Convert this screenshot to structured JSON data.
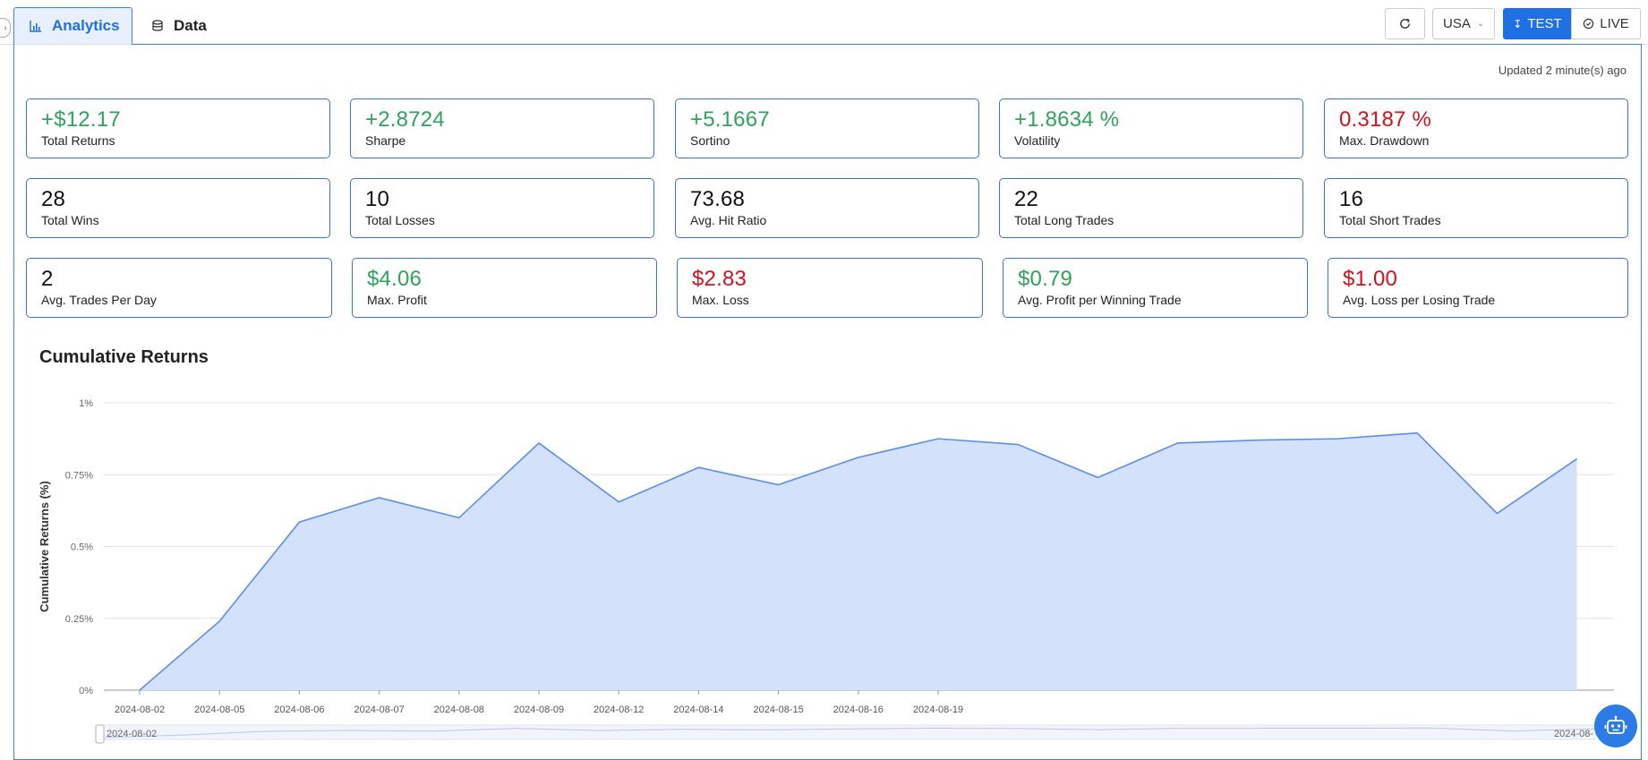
{
  "tabs": [
    {
      "label": "Analytics",
      "icon": "bar-chart-icon",
      "active": true
    },
    {
      "label": "Data",
      "icon": "database-icon",
      "active": false
    }
  ],
  "toolbar": {
    "refresh_icon": "refresh-icon",
    "market": "USA",
    "test_label": "TEST",
    "live_label": "LIVE",
    "accent_color": "#1f6fe5"
  },
  "updated_text": "Updated 2 minute(s) ago",
  "metrics_row1": [
    {
      "value": "+$12.17",
      "label": "Total Returns",
      "tone": "pos"
    },
    {
      "value": "+2.8724",
      "label": "Sharpe",
      "tone": "pos"
    },
    {
      "value": "+5.1667",
      "label": "Sortino",
      "tone": "pos"
    },
    {
      "value": "+1.8634 %",
      "label": "Volatility",
      "tone": "pos"
    },
    {
      "value": "0.3187 %",
      "label": "Max. Drawdown",
      "tone": "neg"
    }
  ],
  "metrics_row2": [
    {
      "value": "28",
      "label": "Total Wins",
      "tone": "neutral"
    },
    {
      "value": "10",
      "label": "Total Losses",
      "tone": "neutral"
    },
    {
      "value": "73.68",
      "label": "Avg. Hit Ratio",
      "tone": "neutral"
    },
    {
      "value": "22",
      "label": "Total Long Trades",
      "tone": "neutral"
    },
    {
      "value": "16",
      "label": "Total Short Trades",
      "tone": "neutral"
    }
  ],
  "metrics_row3": [
    {
      "value": "2",
      "label": "Avg. Trades Per Day",
      "tone": "neutral"
    },
    {
      "value": "$4.06",
      "label": "Max. Profit",
      "tone": "pos"
    },
    {
      "value": "$2.83",
      "label": "Max. Loss",
      "tone": "neg"
    },
    {
      "value": "$0.79",
      "label": "Avg. Profit per Winning Trade",
      "tone": "pos"
    },
    {
      "value": "$1.00",
      "label": "Avg. Loss per Losing Trade",
      "tone": "neg"
    }
  ],
  "chart_title": "Cumulative Returns",
  "chart_data": {
    "type": "area",
    "title": "Cumulative Returns",
    "ylabel": "Cumulative Returns (%)",
    "xlabel": "",
    "ylim": [
      0,
      1
    ],
    "y_ticks": [
      "0%",
      "0.25%",
      "0.5%",
      "0.75%",
      "1%"
    ],
    "x_tick_labels": [
      "2024-08-02",
      "2024-08-05",
      "2024-08-06",
      "2024-08-07",
      "2024-08-08",
      "2024-08-09",
      "2024-08-12",
      "2024-08-14",
      "2024-08-15",
      "2024-08-16",
      "2024-08-19"
    ],
    "values": [
      0.0,
      0.24,
      0.585,
      0.67,
      0.6,
      0.86,
      0.655,
      0.775,
      0.715,
      0.81,
      0.875,
      0.855,
      0.74,
      0.86,
      0.87,
      0.875,
      0.895,
      0.615,
      0.805
    ],
    "grid": true,
    "line_color": "#5b8def",
    "fill_color": "#d4e1fa",
    "slider_start_label": "2024-08-02",
    "slider_end_label": "2024-08-"
  },
  "assistant_icon": "robot-icon"
}
